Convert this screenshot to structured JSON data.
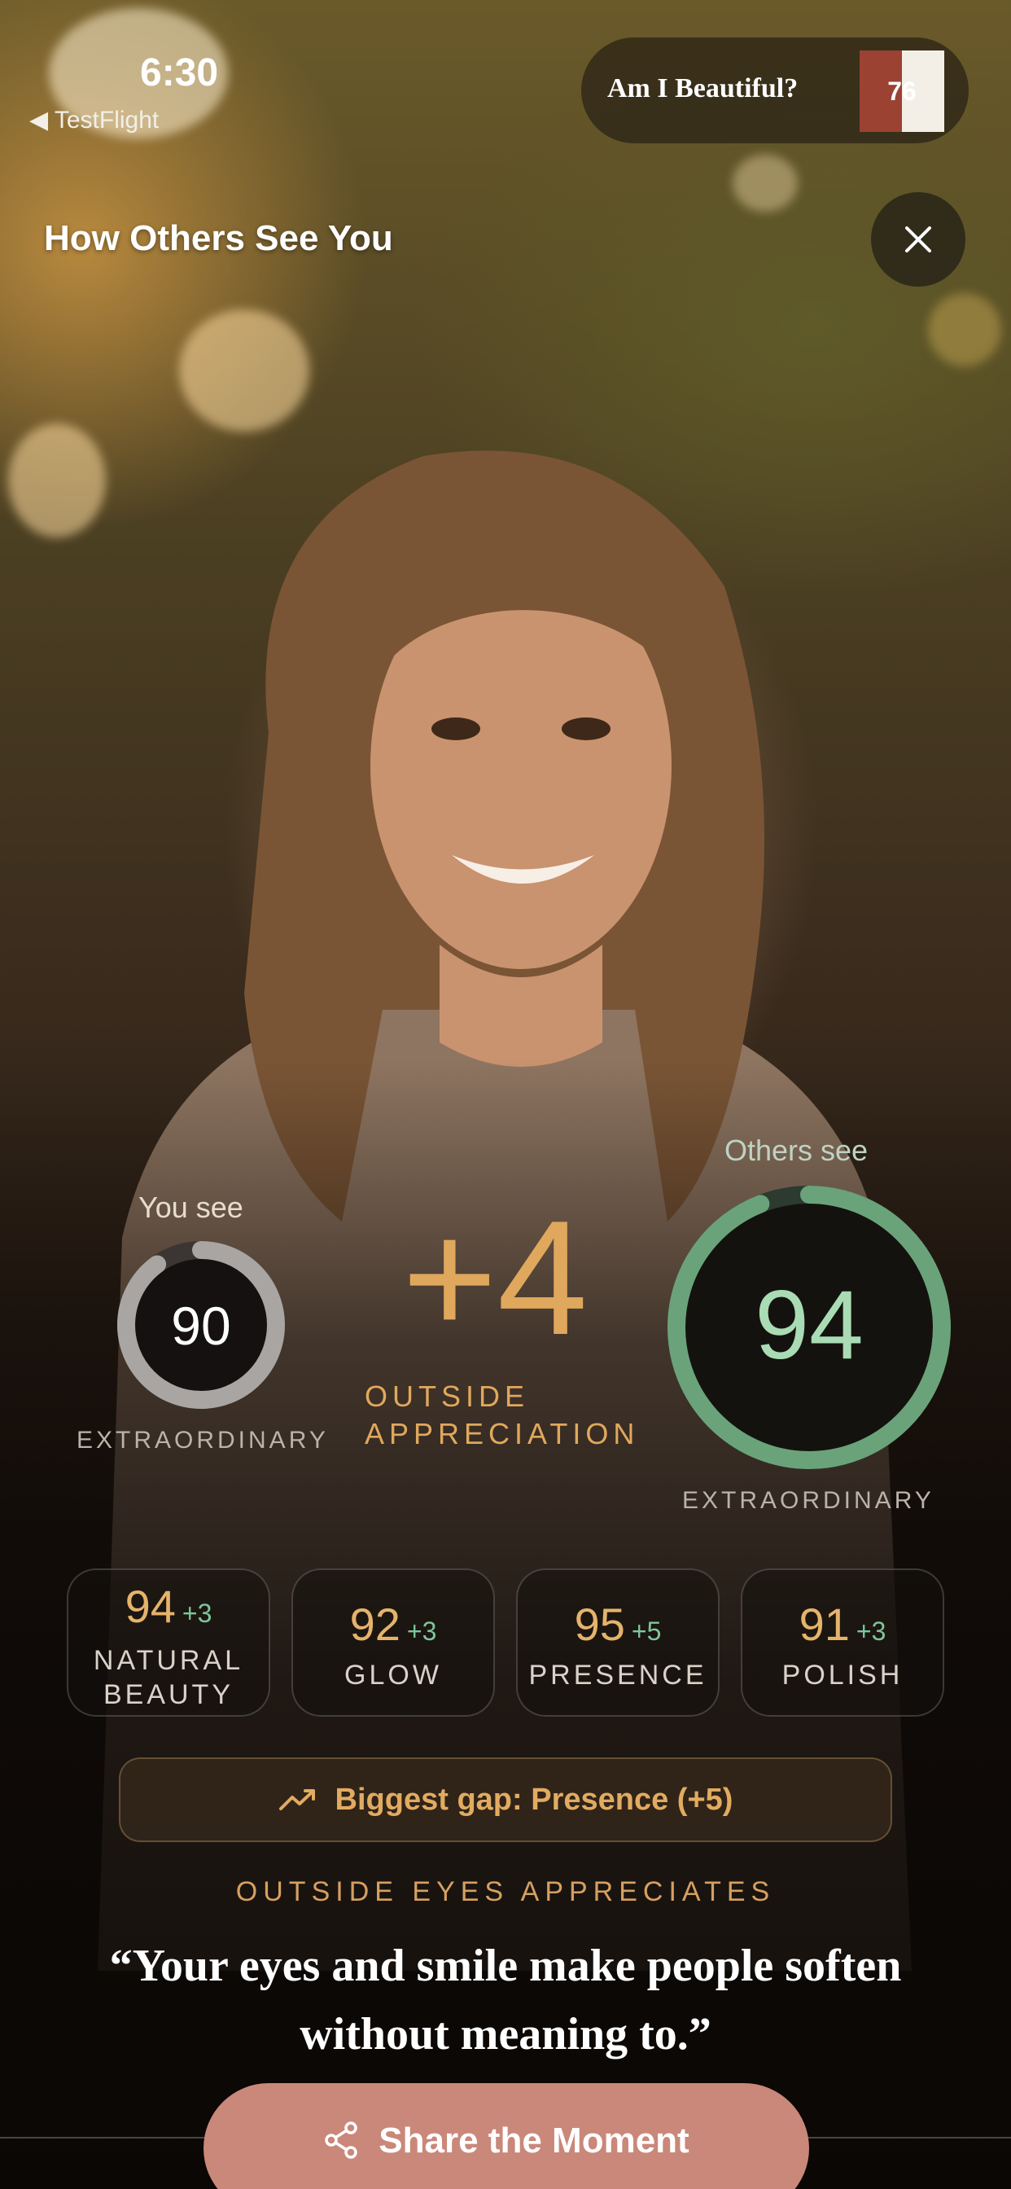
{
  "status_bar": {
    "time": "6:30",
    "back_app": "◀ TestFlight",
    "pill_title": "Am I Beautiful?",
    "battery": "76"
  },
  "header": {
    "title": "How Others See You",
    "close_icon": "close-icon"
  },
  "self_score": {
    "label": "You see",
    "value": "90",
    "fraction": 0.9,
    "rating": "EXTRAORDINARY",
    "ring_color": "#a9a5a2"
  },
  "others_score": {
    "label": "Others see",
    "value": "94",
    "fraction": 0.94,
    "rating": "EXTRAORDINARY",
    "ring_color": "#6aa37a"
  },
  "delta": {
    "value": "+4",
    "label_line1": "OUTSIDE",
    "label_line2": "APPRECIATION"
  },
  "metrics": [
    {
      "value": "94",
      "delta": "+3",
      "label_line1": "NATURAL",
      "label_line2": "BEAUTY"
    },
    {
      "value": "92",
      "delta": "+3",
      "label_line1": "GLOW",
      "label_line2": ""
    },
    {
      "value": "95",
      "delta": "+5",
      "label_line1": "PRESENCE",
      "label_line2": ""
    },
    {
      "value": "91",
      "delta": "+3",
      "label_line1": "POLISH",
      "label_line2": ""
    }
  ],
  "gap": {
    "icon": "trending-up-icon",
    "text": "Biggest gap: Presence (+5)"
  },
  "appreciates": {
    "label": "OUTSIDE EYES APPRECIATES",
    "quote": "“Your eyes and smile make people soften without meaning to.”"
  },
  "share": {
    "icon": "share-icon",
    "label": "Share the Moment"
  },
  "colors": {
    "accent_gold": "#e0a85c",
    "accent_green": "#7cc79b",
    "share_button": "#c9887a"
  }
}
